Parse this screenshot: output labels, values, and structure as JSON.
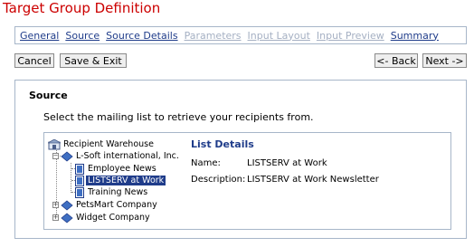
{
  "page": {
    "title": "Target Group Definition"
  },
  "tabs": [
    {
      "label": "General",
      "state": "link"
    },
    {
      "label": "Source",
      "state": "active"
    },
    {
      "label": "Source Details",
      "state": "link"
    },
    {
      "label": "Parameters",
      "state": "disabled"
    },
    {
      "label": "Input Layout",
      "state": "disabled"
    },
    {
      "label": "Input Preview",
      "state": "disabled"
    },
    {
      "label": "Summary",
      "state": "link"
    }
  ],
  "buttons": {
    "cancel": "Cancel",
    "save_exit": "Save & Exit",
    "back": "<- Back",
    "next": "Next ->"
  },
  "source": {
    "title": "Source",
    "instruction": "Select the mailing list to retrieve your recipients from."
  },
  "tree": {
    "root": "Recipient Warehouse",
    "company1": "L-Soft international, Inc.",
    "list1": "Employee News",
    "list2": "LISTSERV at Work",
    "list3": "Training News",
    "company2": "PetsMart Company",
    "company3": "Widget Company"
  },
  "details": {
    "title": "List Details",
    "name_label": "Name:",
    "name_value": "LISTSERV at Work",
    "description_label": "Description:",
    "description_value": "LISTSERV at Work Newsletter"
  },
  "colors": {
    "title_red": "#cc0000",
    "link_blue": "#1f3c8a",
    "disabled": "#a5b0c3",
    "border": "#a7b6c9"
  }
}
